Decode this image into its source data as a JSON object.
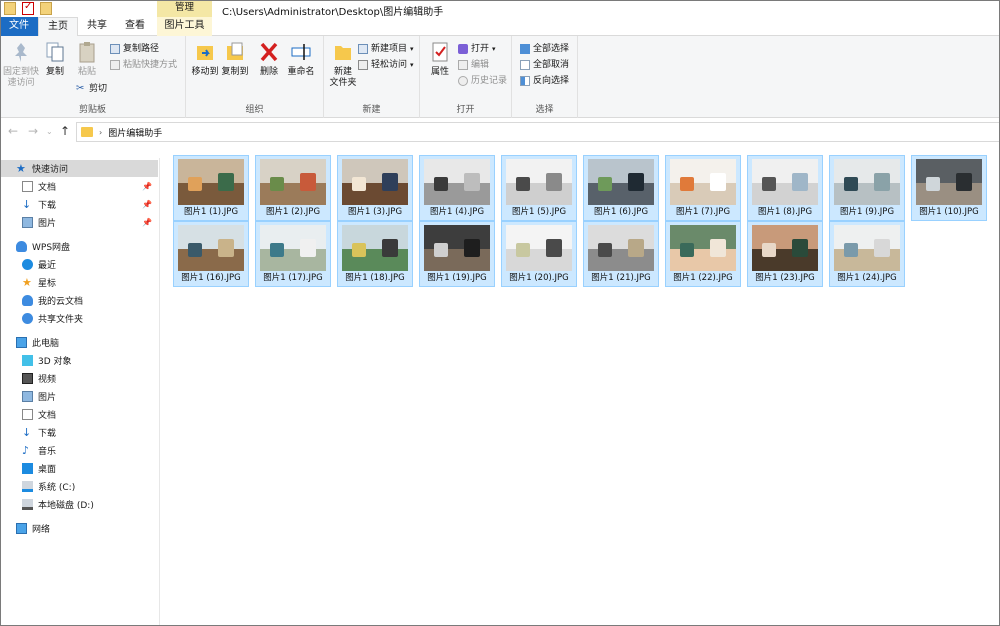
{
  "window": {
    "path_title": "C:\\Users\\Administrator\\Desktop\\图片编辑助手",
    "context_tab_header": "管理"
  },
  "tabs": {
    "file": "文件",
    "home": "主页",
    "share": "共享",
    "view": "查看",
    "picture_tools": "图片工具"
  },
  "ribbon": {
    "clipboard": {
      "label": "剪贴板",
      "pin_quick_access_l1": "固定到快",
      "pin_quick_access_l2": "速访问",
      "copy": "复制",
      "paste": "粘贴",
      "copy_path": "复制路径",
      "paste_shortcut": "粘贴快捷方式",
      "cut": "剪切"
    },
    "organize": {
      "label": "组织",
      "move_to": "移动到",
      "copy_to": "复制到",
      "delete": "删除",
      "rename": "重命名"
    },
    "new": {
      "label": "新建",
      "new_folder_l1": "新建",
      "new_folder_l2": "文件夹",
      "new_item": "新建项目",
      "easy_access": "轻松访问"
    },
    "open": {
      "label": "打开",
      "properties": "属性",
      "open": "打开",
      "edit": "编辑",
      "history": "历史记录"
    },
    "select": {
      "label": "选择",
      "select_all": "全部选择",
      "select_none": "全部取消",
      "invert": "反向选择"
    }
  },
  "address": {
    "crumb": "图片编辑助手"
  },
  "sidebar": {
    "quick_access": "快速访问",
    "qa_documents": "文档",
    "qa_downloads": "下载",
    "qa_pictures": "图片",
    "wps_cloud": "WPS网盘",
    "recent": "最近",
    "starred": "星标",
    "my_cloud_docs": "我的云文档",
    "shared_folders": "共享文件夹",
    "this_pc": "此电脑",
    "objects_3d": "3D 对象",
    "videos": "视频",
    "pictures": "图片",
    "documents": "文档",
    "downloads": "下载",
    "music": "音乐",
    "desktop": "桌面",
    "system_c": "系统 (C:)",
    "local_d": "本地磁盘 (D:)",
    "network": "网络"
  },
  "files": [
    "图片1 (1).JPG",
    "图片1 (2).JPG",
    "图片1 (3).JPG",
    "图片1 (4).JPG",
    "图片1 (5).JPG",
    "图片1 (6).JPG",
    "图片1 (7).JPG",
    "图片1 (8).JPG",
    "图片1 (9).JPG",
    "图片1 (10).JPG",
    "图片1 (16).JPG",
    "图片1 (17).JPG",
    "图片1 (18).JPG",
    "图片1 (19).JPG",
    "图片1 (20).JPG",
    "图片1 (21).JPG",
    "图片1 (22).JPG",
    "图片1 (23).JPG",
    "图片1 (24).JPG"
  ],
  "colors": {
    "file_tab": "#1c6cc4",
    "selection_fill": "#cce8ff",
    "selection_border": "#99d1ff",
    "context_tab": "#f4e7a5"
  }
}
